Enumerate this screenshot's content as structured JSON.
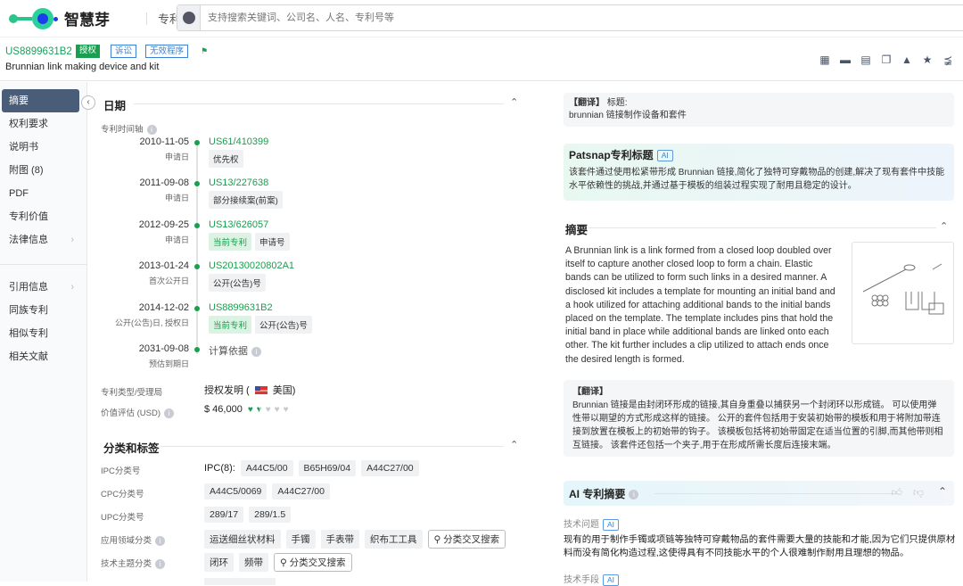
{
  "header": {
    "brand": "智慧芽",
    "nav": "专利",
    "search_placeholder": "支持搜索关键词、公司名、人名、专利号等"
  },
  "patent": {
    "number": "US8899631B2",
    "badges": [
      "授权",
      "诉讼",
      "无效程序"
    ],
    "title": "Brunnian link making device and kit"
  },
  "toolbar": [
    "pdf-download-icon",
    "folder-icon",
    "report-icon",
    "compare-icon",
    "export-icon",
    "star-icon",
    "share-icon"
  ],
  "sidebar": {
    "items": [
      "摘要",
      "权利要求",
      "说明书",
      "附图 (8)",
      "PDF",
      "专利价值",
      "法律信息"
    ],
    "items2": [
      "引用信息",
      "同族专利",
      "相似专利",
      "相关文献"
    ]
  },
  "dates": {
    "title": "日期",
    "timeline_label": "专利时间轴",
    "events": [
      {
        "date": "2010-11-05",
        "type": "申请日",
        "number": "US61/410399",
        "tags": [
          "优先权"
        ],
        "green": []
      },
      {
        "date": "2011-09-08",
        "type": "申请日",
        "number": "US13/227638",
        "tags": [
          "部分接续案(前案)"
        ],
        "green": []
      },
      {
        "date": "2012-09-25",
        "type": "申请日",
        "number": "US13/626057",
        "tags": [
          "申请号"
        ],
        "green": [
          "当前专利"
        ]
      },
      {
        "date": "2013-01-24",
        "type": "首次公开日",
        "number": "US20130020802A1",
        "tags": [
          "公开(公告)号"
        ],
        "green": []
      },
      {
        "date": "2014-12-02",
        "type": "公开(公告)日, 授权日",
        "number": "US8899631B2",
        "tags": [
          "公开(公告)号"
        ],
        "green": [
          "当前专利"
        ]
      },
      {
        "date": "2031-09-08",
        "type": "预估到期日",
        "number": "计算依据",
        "tags": [],
        "green": []
      }
    ],
    "type_label": "专利类型/受理局",
    "type_value": "授权发明 (",
    "country": "美国)",
    "value_label": "价值评估 (USD)",
    "value": "$ 46,000",
    "value_rating": 1.5,
    "value_max": 5
  },
  "classification": {
    "title": "分类和标签",
    "ipc_label": "IPC分类号",
    "ipc_prefix": "IPC(8):",
    "ipc": [
      "A44C5/00",
      "B65H69/04",
      "A44C27/00"
    ],
    "cpc_label": "CPC分类号",
    "cpc": [
      "A44C5/0069",
      "A44C27/00"
    ],
    "upc_label": "UPC分类号",
    "upc": [
      "289/17",
      "289/1.5"
    ],
    "app_label": "应用领域分类",
    "app": [
      "运送细丝状材料",
      "手镯",
      "手表带",
      "织布工工具"
    ],
    "tech_label": "技术主题分类",
    "tech": [
      "闭环",
      "频带"
    ],
    "cross_search": "分类交叉搜索"
  },
  "right": {
    "title_trans_label": "【翻译】",
    "title_trans_head": "标题:",
    "title_trans": "brunnian 链接制作设备和套件",
    "ai_title_label": "Patsnap专利标题",
    "ai": "AI",
    "ai_title": "该套件通过使用松紧带形成 Brunnian 链接,简化了独特可穿戴物品的创建,解决了现有套件中技能水平依赖性的挑战,并通过基于模板的组装过程实现了耐用且稳定的设计。",
    "abstract_title": "摘要",
    "abstract": "A Brunnian link is a link formed from a closed loop doubled over itself to capture another closed loop to form a chain. Elastic bands can be utilized to form such links in a desired manner. A disclosed kit includes a template for mounting an initial band and a hook utilized for attaching additional bands to the initial bands placed on the template. The template includes pins that hold the initial band in place while additional bands are linked onto each other. The kit further includes a clip utilized to attach ends once the desired length is formed.",
    "abs_trans_label": "【翻译】",
    "abs_trans": "Brunnian 链接是由封闭环形成的链接,其自身重叠以捕获另一个封闭环以形成链。 可以使用弹性带以期望的方式形成这样的链接。 公开的套件包括用于安装初始带的模板和用于将附加带连接到放置在模板上的初始带的钩子。 该模板包括将初始带固定在适当位置的引脚,而其他带则相互链接。 该套件还包括一个夹子,用于在形成所需长度后连接末端。",
    "ai_summary_title": "AI 专利摘要",
    "problem_label": "技术问题",
    "problem": "现有的用于制作手镯或项链等独特可穿戴物品的套件需要大量的技能和才能,因为它们只提供原材料而没有简化构造过程,这使得具有不同技能水平的个人很难制作耐用且理想的物品。",
    "means_label": "技术手段"
  }
}
